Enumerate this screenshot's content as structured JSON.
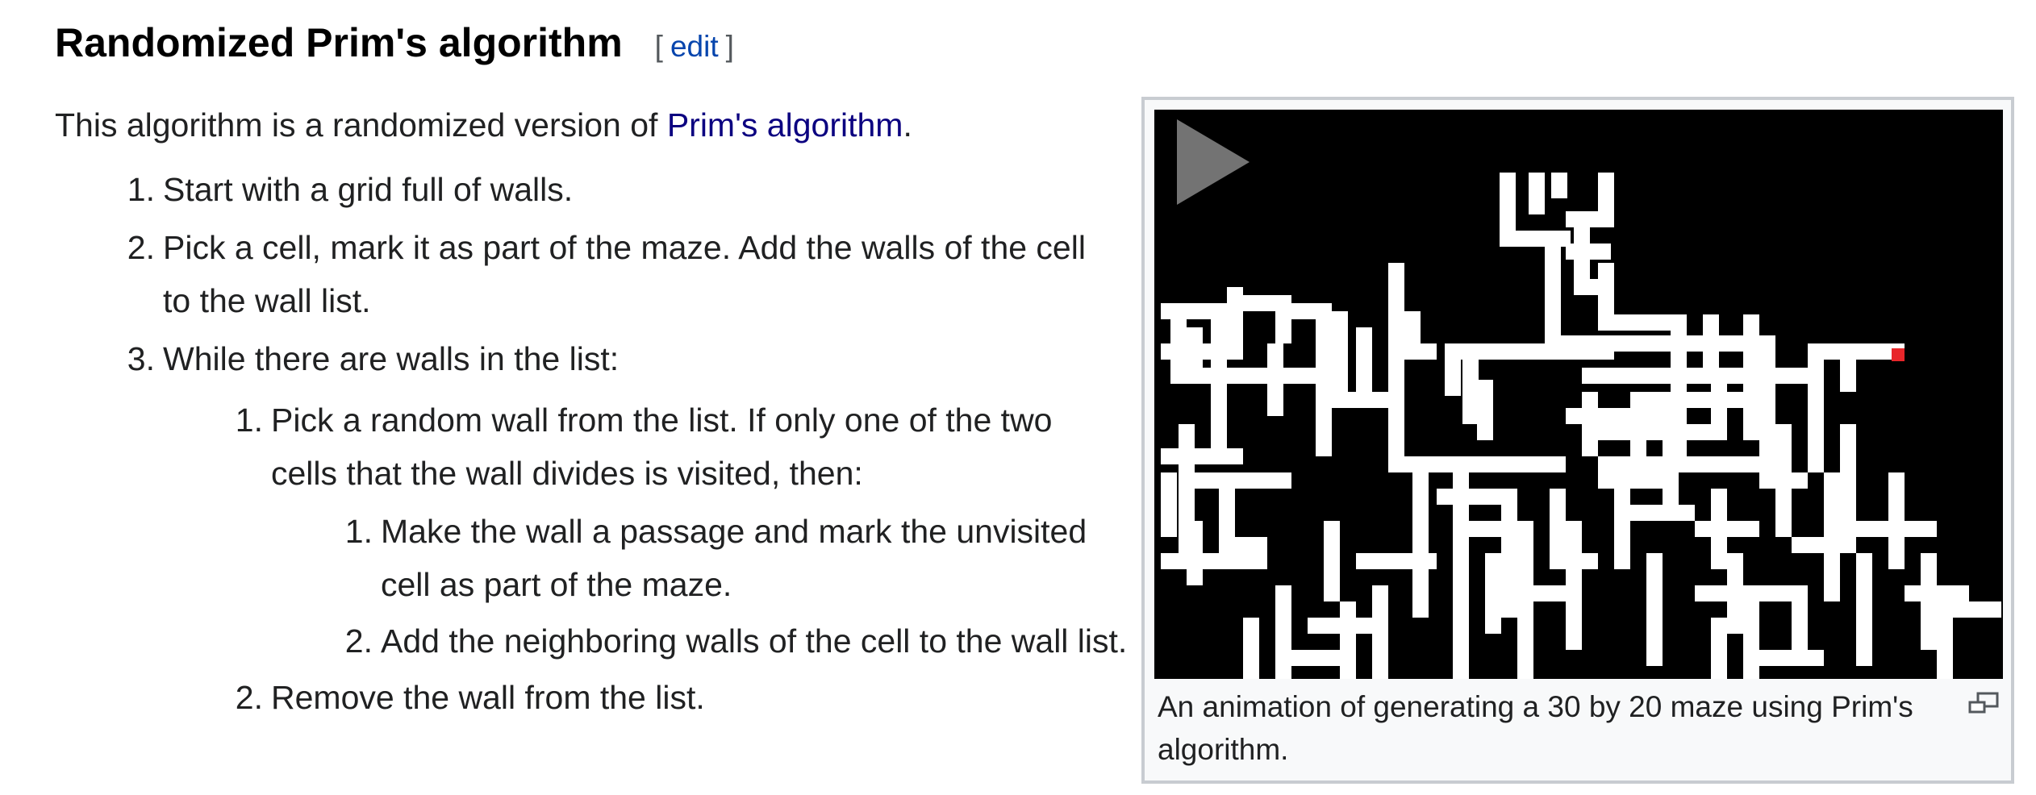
{
  "heading": {
    "title": "Randomized Prim's algorithm",
    "edit_open": "[",
    "edit_label": "edit",
    "edit_close": "]"
  },
  "intro": {
    "text_before": "This algorithm is a randomized version of ",
    "link_text": "Prim's algorithm",
    "text_after": "."
  },
  "steps": [
    {
      "num": "1.",
      "text": "Start with a grid full of walls."
    },
    {
      "num": "2.",
      "text": "Pick a cell, mark it as part of the maze. Add the walls of the cell to the wall list."
    },
    {
      "num": "3.",
      "text": "While there are walls in the list:"
    }
  ],
  "substeps": [
    {
      "num": "1.",
      "text": "Pick a random wall from the list. If only one of the two cells that the wall divides is visited, then:"
    },
    {
      "num": "2.",
      "text": "Remove the wall from the list."
    }
  ],
  "subsubsteps": [
    {
      "num": "1.",
      "text": "Make the wall a passage and mark the unvisited cell as part of the maze."
    },
    {
      "num": "2.",
      "text": "Add the neighboring walls of the cell to the wall list."
    }
  ],
  "figure": {
    "caption": "An animation of generating a 30 by 20 maze using Prim's algorithm.",
    "magnify_icon": "magnify-icon",
    "play_icon": "play-icon",
    "maze_color": "#ffffff",
    "current_cell_color": "#e8262a",
    "background_color": "#000000"
  }
}
